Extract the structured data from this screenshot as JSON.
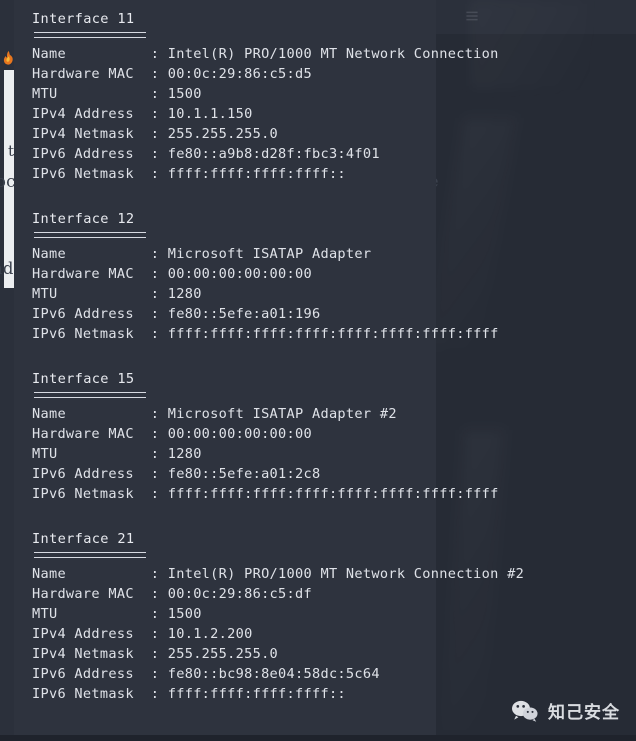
{
  "window": {
    "background_color": "#262b35",
    "terminal_background_color": "#2e333e",
    "text_color": "#dfe2e8"
  },
  "browser_chrome": {
    "toolbar_icons": [
      {
        "name": "library-icon"
      },
      {
        "name": "reader-view-icon"
      },
      {
        "name": "pocket-icon"
      },
      {
        "name": "account-icon"
      },
      {
        "name": "extensions-icon"
      },
      {
        "name": "hamburger-menu-icon"
      }
    ],
    "tab_favicon": "firefox-icon",
    "background_page_text": {
      "line1": "occurred and the actions you performed just before",
      "line2": "ndle the req",
      "line3": "t"
    }
  },
  "terminal": {
    "label_width": 13,
    "separator": " : ",
    "interfaces": [
      {
        "title": "Interface 11",
        "rows": [
          {
            "label": "Name",
            "value": "Intel(R) PRO/1000 MT Network Connection"
          },
          {
            "label": "Hardware MAC",
            "value": "00:0c:29:86:c5:d5"
          },
          {
            "label": "MTU",
            "value": "1500"
          },
          {
            "label": "IPv4 Address",
            "value": "10.1.1.150"
          },
          {
            "label": "IPv4 Netmask",
            "value": "255.255.255.0"
          },
          {
            "label": "IPv6 Address",
            "value": "fe80::a9b8:d28f:fbc3:4f01"
          },
          {
            "label": "IPv6 Netmask",
            "value": "ffff:ffff:ffff:ffff::"
          }
        ]
      },
      {
        "title": "Interface 12",
        "rows": [
          {
            "label": "Name",
            "value": "Microsoft ISATAP Adapter"
          },
          {
            "label": "Hardware MAC",
            "value": "00:00:00:00:00:00"
          },
          {
            "label": "MTU",
            "value": "1280"
          },
          {
            "label": "IPv6 Address",
            "value": "fe80::5efe:a01:196"
          },
          {
            "label": "IPv6 Netmask",
            "value": "ffff:ffff:ffff:ffff:ffff:ffff:ffff:ffff"
          }
        ]
      },
      {
        "title": "Interface 15",
        "rows": [
          {
            "label": "Name",
            "value": "Microsoft ISATAP Adapter #2"
          },
          {
            "label": "Hardware MAC",
            "value": "00:00:00:00:00:00"
          },
          {
            "label": "MTU",
            "value": "1280"
          },
          {
            "label": "IPv6 Address",
            "value": "fe80::5efe:a01:2c8"
          },
          {
            "label": "IPv6 Netmask",
            "value": "ffff:ffff:ffff:ffff:ffff:ffff:ffff:ffff"
          }
        ]
      },
      {
        "title": "Interface 21",
        "rows": [
          {
            "label": "Name",
            "value": "Intel(R) PRO/1000 MT Network Connection #2"
          },
          {
            "label": "Hardware MAC",
            "value": "00:0c:29:86:c5:df"
          },
          {
            "label": "MTU",
            "value": "1500"
          },
          {
            "label": "IPv4 Address",
            "value": "10.1.2.200"
          },
          {
            "label": "IPv4 Netmask",
            "value": "255.255.255.0"
          },
          {
            "label": "IPv6 Address",
            "value": "fe80::bc98:8e04:58dc:5c64"
          },
          {
            "label": "IPv6 Netmask",
            "value": "ffff:ffff:ffff:ffff::"
          }
        ]
      }
    ]
  },
  "watermark": {
    "icon": "wechat-icon",
    "text": "知己安全"
  }
}
